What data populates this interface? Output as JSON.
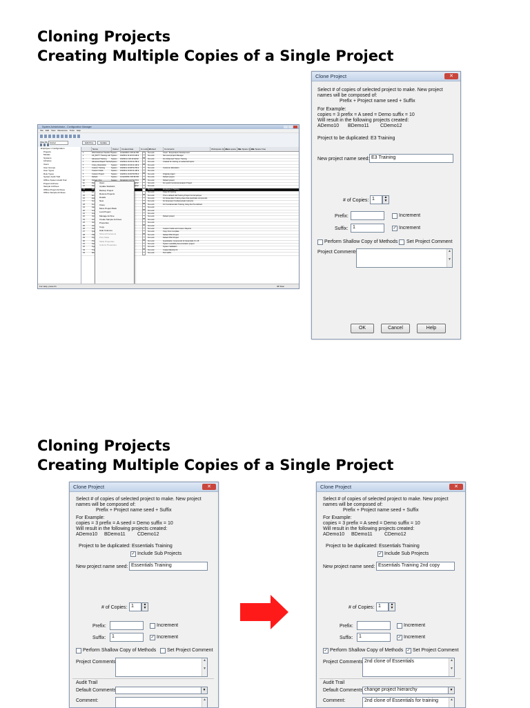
{
  "slides": [
    {
      "title_line1": "Cloning Projects",
      "title_line2": "Creating Multiple Copies of a Single Project"
    },
    {
      "title_line1": "Cloning Projects",
      "title_line2": "Creating Multiple Copies of a Single Project"
    }
  ],
  "colors": {
    "arrow": "#ff1a1a",
    "selected_row": "#111111",
    "close_button": "#c9463d"
  },
  "app_window": {
    "title": "System Administrator - Configuration Manager",
    "menu": [
      "File",
      "Edit",
      "View",
      "Resources",
      "Tools",
      "Help"
    ],
    "filter_label": "Filter By",
    "filter_value": "Global",
    "toolbar_buttons": [
      "Edit Proj",
      "Update"
    ],
    "tree": [
      "Employee 1 Configuration",
      "Projects",
      "Models",
      "Systems",
      "Libraries",
      "Users",
      "User Groups",
      "User Types",
      "Role Types",
      "System Audit Trail",
      "Offline System Audit Trail",
      "Project Archives",
      "Sample Archives",
      "Offline Project Archives",
      "Offline Sample Archives"
    ],
    "columns": [
      "Name",
      "Owner",
      "Created date",
      "Is Locked?",
      "Locked",
      "Comments",
      "Workspace Quota",
      "Data space Free",
      "File Space Quota",
      "File Space Free"
    ],
    "rows": [
      {
        "name": "2012 Defense Transfer Tests",
        "owner": "System",
        "date": "12/12/2010 3:35:22 PM EST",
        "locked": "No Lock",
        "comments": "Cover: Temperature Development"
      },
      {
        "name": "AD_BOTT Training Lab Ver",
        "owner": "System",
        "date": "3/4/2011 11:40:33 AM EST",
        "locked": "No Lock",
        "comments": "Not used project Manager"
      },
      {
        "name": "Advanced Training",
        "owner": "System",
        "date": "3/4/2011 4:18:19 AM EST",
        "locked": "No Lock",
        "comments": "For Advanced Trainer Training"
      },
      {
        "name": "Advanced Rapid Training",
        "owner": "System",
        "date": "3/4/2011 10:42:11 PM EST",
        "locked": "No Lock",
        "comments": "Created for training on advanced topics"
      },
      {
        "name": "Cross_Dissolution",
        "owner": "System",
        "date": "3/4/2011 10:43:11 AM EST",
        "locked": "No Lock",
        "comments": ""
      },
      {
        "name": "Custom Training",
        "owner": "System",
        "date": "3/4/2011 10:38:51 PM EST",
        "locked": "No Lock",
        "comments": "Customer Education"
      },
      {
        "name": "Custom Fields",
        "owner": "System",
        "date": "3/4/2011 10:40:11 AM EST",
        "locked": "No Lock",
        "comments": ""
      },
      {
        "name": "Custom Project",
        "owner": "System",
        "date": "4/4/2011 10:40:53 PM EST",
        "locked": "No Lock",
        "comments": "Original project"
      },
      {
        "name": "Default",
        "owner": "System",
        "date": "12/12/2009 3:38:38 PM EST",
        "locked": "No Lock",
        "comments": "Default project"
      },
      {
        "name": "Default_Proj",
        "owner": "System",
        "date": "5/19/2010 3:37:52 PM EST",
        "locked": "No Lock",
        "comments": "Default project"
      },
      {
        "name": "Demo",
        "owner": "System",
        "date": "3/4/2011 5:55:54 AM EST",
        "locked": "No Lock",
        "comments": "For quick Functional analysis Project"
      },
      {
        "name": "Demo_1",
        "owner": "System",
        "date": "3/4/2011 5:55:54 AM EST",
        "locked": "No Lock",
        "comments": ""
      },
      {
        "name": "E3 Training",
        "owner": "",
        "date": "",
        "locked": "No Lock",
        "comments": "Employee 3 Training"
      },
      {
        "name": "E3 Training Copy",
        "owner": "",
        "date": "",
        "locked": "No Lock",
        "comments": "Copy for training"
      },
      {
        "name": "Employee 1 GE Training",
        "owner": "",
        "date": "",
        "locked": "No Lock",
        "comments": "This is default GE Training Project For Employee"
      },
      {
        "name": "Essentials Training",
        "owner": "",
        "date": "",
        "locked": "No Lock",
        "comments": "For Essentials Training class that quantitate compounds"
      },
      {
        "name": "Fundamentals",
        "owner": "",
        "date": "",
        "locked": "No Lock",
        "comments": "For Empower Fundamentals Instructor"
      },
      {
        "name": "Fundamentals Training",
        "owner": "",
        "date": "",
        "locked": "No Lock",
        "comments": "For Fundamentals Training Using the Pre-defined"
      },
      {
        "name": "Hendger_Off_Beat_2014_3EA",
        "owner": "",
        "date": "",
        "locked": "No Lock",
        "comments": ""
      },
      {
        "name": "Group_CustomField",
        "owner": "",
        "date": "",
        "locked": "No Lock",
        "comments": ""
      },
      {
        "name": "Group_CustomField_Archive",
        "owner": "",
        "date": "",
        "locked": "No Lock",
        "comments": ""
      },
      {
        "name": "Version 2011 Intermediate",
        "owner": "",
        "date": "",
        "locked": "No Lock",
        "comments": "Default project"
      },
      {
        "name": "Version 2011_CustomField",
        "owner": "",
        "date": "",
        "locked": "No Lock",
        "comments": ""
      },
      {
        "name": "Version 2011_CustomField2",
        "owner": "",
        "date": "",
        "locked": "No Lock",
        "comments": ""
      },
      {
        "name": "Version 2011_Intermediate_Ext",
        "owner": "",
        "date": "",
        "locked": "No Lock",
        "comments": ""
      },
      {
        "name": "Version_2007_Intermediate",
        "owner": "",
        "date": "",
        "locked": "No Lock",
        "comments": "Custom Fields and Custom Reports"
      },
      {
        "name": "Quick Fit Plus",
        "owner": "",
        "date": "",
        "locked": "No Lock",
        "comments": "Copy From template"
      },
      {
        "name": "PDA Analysis",
        "owner": "",
        "date": "",
        "locked": "No Lock",
        "comments": "Default PDA Project"
      },
      {
        "name": "PQ-2 Training",
        "owner": "",
        "date": "",
        "locked": "No Lock",
        "comments": "Default PDA Project"
      },
      {
        "name": "ProE_W_ta_is_ETSFL_Asterix_Bef",
        "owner": "",
        "date": "",
        "locked": "No Lock",
        "comments": "Quantitation compounds for Essentials 0.1.15"
      },
      {
        "name": "SuiteCalc Default",
        "owner": "",
        "date": "",
        "locked": "No Lock",
        "comments": "System suitability demonstration project"
      },
      {
        "name": "System Fit",
        "owner": "",
        "date": "",
        "locked": "No Lock",
        "comments": "System Validation"
      },
      {
        "name": "Training_Maturity_Guide_BFF",
        "owner": "",
        "date": "",
        "locked": "No Lock",
        "comments": "Create Maturity Fit"
      },
      {
        "name": "Welcome",
        "owner": "",
        "date": "",
        "locked": "No Lock",
        "comments": "PLX DATA"
      }
    ],
    "selected_row_index": 12,
    "context_menu": [
      "Open",
      "Update Statistics",
      "Backup Project",
      "Restore Projects",
      "Details",
      "New",
      "Clone",
      "Move Project Back",
      "Lock Project",
      "Manage Archive",
      "Create Sample Archives",
      "Properties",
      "Copy",
      "Hide Columns",
      "Show All Columns",
      "Print Table",
      "Table Properties",
      "Column Properties"
    ],
    "status_left": "For Help, press F1",
    "status_right": "38 Total"
  },
  "clone_dialog_1": {
    "title": "Clone Project",
    "intro_line1": "Select # of copies of selected project to make.  New project",
    "intro_line2": "names will be composed of:",
    "formula": "Prefix + Project name seed + Suffix",
    "example_title": "For Example:",
    "example_params": "copies = 3     prefix = A      seed = Demo      suffix = 10",
    "example_result": "Will result in the following projects created:",
    "example_names": [
      "ADemo10",
      "BDemo11",
      "CDemo12"
    ],
    "duplicate_label": "Project to be duplicated:",
    "duplicate_value": "E3 Training",
    "seed_label": "New project name seed:",
    "seed_value": "E3 Training",
    "copies_label": "# of Copies:",
    "copies_value": "1",
    "prefix_label": "Prefix:",
    "prefix_value": "",
    "suffix_label": "Suffix:",
    "suffix_value": "1",
    "increment_label": "Increment",
    "prefix_increment_checked": false,
    "suffix_increment_checked": true,
    "shallow_copy_label": "Perform Shallow Copy of Methods",
    "shallow_copy_checked": false,
    "set_comment_label": "Set Project Comment",
    "set_comment_checked": false,
    "comments_label": "Project Comments:",
    "comments_value": "",
    "ok_label": "OK",
    "cancel_label": "Cancel",
    "help_label": "Help"
  },
  "clone_dialog_2": {
    "title": "Clone Project",
    "intro_line1": "Select # of copies of selected project to make.  New project",
    "intro_line2": "names will be composed of:",
    "formula": "Prefix + Project name seed + Suffix",
    "example_title": "For Example:",
    "example_params": "copies = 3    prefix = A    seed = Demo    suffix = 10",
    "example_result": "Will result in the following projects created:",
    "example_names": [
      "ADemo10",
      "BDemo11",
      "CDemo12"
    ],
    "duplicate_label": "Project to be duplicated:",
    "duplicate_value": "Essentials Training",
    "include_sub_label": "Include Sub Projects",
    "include_sub_checked": true,
    "seed_label": "New project name seed:",
    "seed_value": "Essentials Training",
    "copies_label": "# of Copies:",
    "copies_value": "1",
    "prefix_label": "Prefix:",
    "prefix_value": "",
    "suffix_label": "Suffix:",
    "suffix_value": "1",
    "increment_label": "Increment",
    "prefix_increment_checked": false,
    "suffix_increment_checked": true,
    "shallow_copy_label": "Perform Shallow Copy of Methods",
    "shallow_copy_checked": false,
    "set_comment_label": "Set Project Comment",
    "set_comment_checked": false,
    "comments_label": "Project Comments:",
    "comments_value": "",
    "audit_label": "Audit Trail",
    "default_comments_label": "Default Comments:",
    "default_comments_value": "",
    "comment_label": "Comment:",
    "comment_value": ""
  },
  "clone_dialog_3": {
    "title": "Clone Project",
    "intro_line1": "Select # of copies of selected project to make.  New project",
    "intro_line2": "names will be composed of:",
    "formula": "Prefix + Project name seed + Suffix",
    "example_title": "For Example:",
    "example_params": "copies = 3    prefix = A    seed = Demo    suffix = 10",
    "example_result": "Will result in the following projects created:",
    "example_names": [
      "ADemo10",
      "BDemo11",
      "CDemo12"
    ],
    "duplicate_label": "Project to be duplicated:",
    "duplicate_value": "Essentials Training",
    "include_sub_label": "Include Sub Projects",
    "include_sub_checked": true,
    "seed_label": "New project name seed:",
    "seed_value": "Essentials Training 2nd copy",
    "copies_label": "# of Copies:",
    "copies_value": "1",
    "prefix_label": "Prefix:",
    "prefix_value": "",
    "suffix_label": "Suffix:",
    "suffix_value": "1",
    "increment_label": "Increment",
    "prefix_increment_checked": false,
    "suffix_increment_checked": true,
    "shallow_copy_label": "Perform Shallow Copy of Methods",
    "shallow_copy_checked": true,
    "set_comment_label": "Set Project Comment",
    "set_comment_checked": true,
    "comments_label": "Project Comments:",
    "comments_value": "2nd clone of Essentials",
    "audit_label": "Audit Trail",
    "default_comments_label": "Default Comments:",
    "default_comments_value": "change project hierarchy",
    "comment_label": "Comment:",
    "comment_value": "2nd clone of Essentials for training"
  }
}
